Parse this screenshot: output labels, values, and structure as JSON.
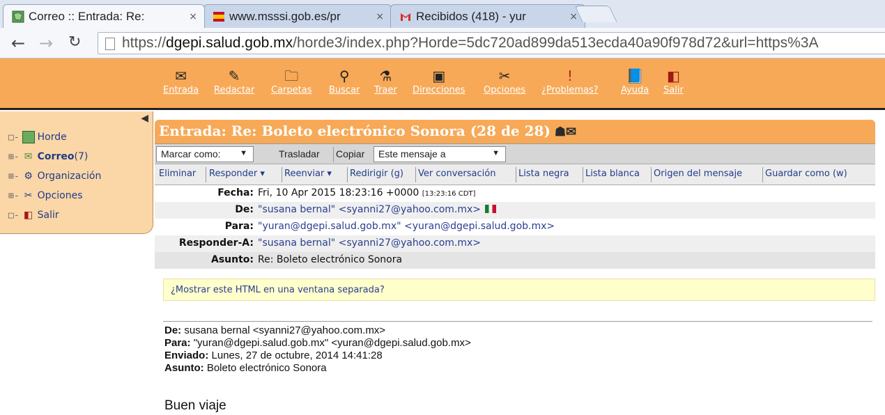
{
  "browser": {
    "tabs": [
      {
        "title": "Correo :: Entrada: Re:",
        "icon": "horde-map-icon"
      },
      {
        "title": "www.msssi.gob.es/pr",
        "icon": "spain-gov-icon"
      },
      {
        "title": "Recibidos (418) - yur",
        "icon": "gmail-icon"
      }
    ],
    "close_glyph": "×",
    "url_prefix": "https://",
    "url_domain": "dgepi.salud.gob.mx",
    "url_path": "/horde3/index.php?Horde=5dc720ad899da513ecda40a90f978d72&url=https%3A"
  },
  "horde_menu": [
    {
      "label": "Entrada",
      "icon": "inbox-envelope-icon"
    },
    {
      "label": "Redactar",
      "icon": "compose-pencil-icon"
    },
    {
      "label": "Carpetas",
      "icon": "folder-icon"
    },
    {
      "label": "Buscar",
      "icon": "search-magnifier-icon"
    },
    {
      "label": "Traer",
      "icon": "fetch-mail-icon"
    },
    {
      "label": "Direcciones",
      "icon": "address-book-icon"
    },
    {
      "label": "Opciones",
      "icon": "tools-icon"
    },
    {
      "label": "¿Problemas?",
      "icon": "exclamation-icon"
    },
    {
      "label": "Ayuda",
      "icon": "help-book-icon"
    },
    {
      "label": "Salir",
      "icon": "logout-door-icon"
    }
  ],
  "sidebar": {
    "items": [
      {
        "tree": "□-",
        "label": "Horde",
        "count": ""
      },
      {
        "tree": "⊞-",
        "label": "Correo",
        "count": " (7)"
      },
      {
        "tree": "⊞-",
        "label": "Organización",
        "count": ""
      },
      {
        "tree": "⊞-",
        "label": "Opciones",
        "count": ""
      },
      {
        "tree": "□-",
        "label": "Salir",
        "count": ""
      }
    ]
  },
  "message": {
    "title": "Entrada: Re: Boleto electrónico Sonora (28 de 28)",
    "mark_as": "Marcar como:",
    "move": "Trasladar",
    "copy": "Copiar",
    "target": "Este mensaje a",
    "actions": [
      "Eliminar",
      "Responder ▾",
      "Reenviar ▾",
      "Redirigir (g)",
      "Ver conversación",
      "Lista negra",
      "Lista blanca",
      "Origen del mensaje",
      "Guardar como (w)"
    ],
    "headers": [
      {
        "label": "Fecha:",
        "value": "Fri, 10 Apr 2015 18:23:16 +0000",
        "extra": "[13:23:16 CDT]"
      },
      {
        "label": "De:",
        "value": "\"susana bernal\" <syanni27@yahoo.com.mx>",
        "extra": ""
      },
      {
        "label": "Para:",
        "value": "\"yuran@dgepi.salud.gob.mx\" <yuran@dgepi.salud.gob.mx>",
        "extra": ""
      },
      {
        "label": "Responder-A:",
        "value": "\"susana bernal\" <syanni27@yahoo.com.mx>",
        "extra": ""
      },
      {
        "label": "Asunto:",
        "value": "Re: Boleto electrónico Sonora",
        "extra": ""
      }
    ],
    "html_notice": "¿Mostrar este HTML en una ventana separada?",
    "quoted": [
      {
        "label": "De:",
        "value": " susana bernal <syanni27@yahoo.com.mx>"
      },
      {
        "label": "Para:",
        "value": " \"yuran@dgepi.salud.gob.mx\" <yuran@dgepi.salud.gob.mx>"
      },
      {
        "label": "Enviado:",
        "value": " Lunes, 27 de octubre, 2014 14:41:28"
      },
      {
        "label": "Asunto:",
        "value": " Boleto electrónico Sonora"
      }
    ],
    "body": "Buen viaje"
  }
}
